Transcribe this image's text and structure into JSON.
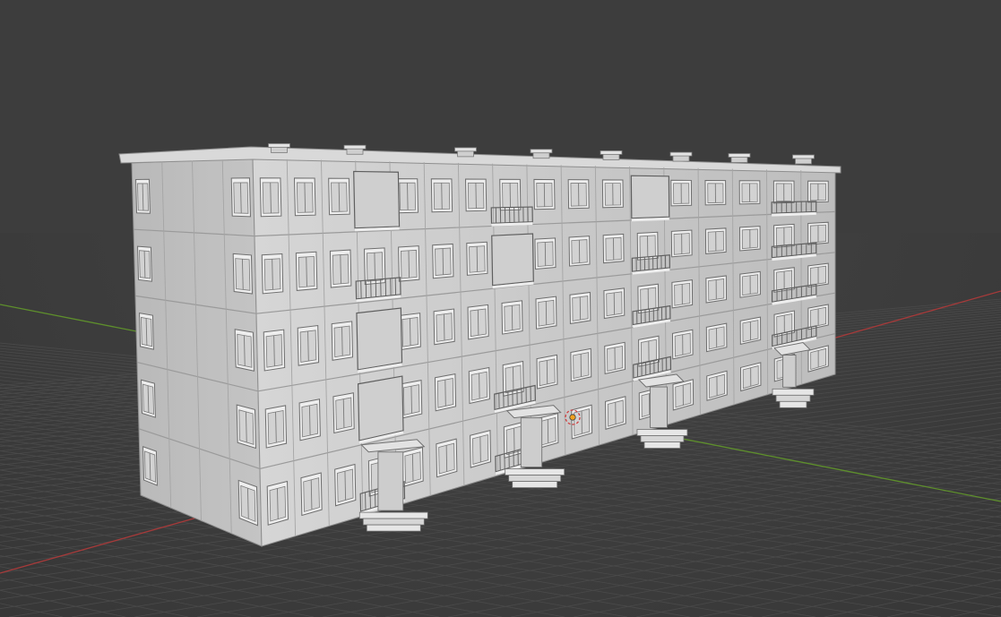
{
  "viewport": {
    "mode": "3d-viewport",
    "shading": "solid",
    "colors": {
      "background": "#3d3d3d",
      "grid": "#4a4a4a",
      "x_axis": "#a63a3a",
      "y_axis": "#5e8f2c",
      "model": "#c9c9c9",
      "origin": "#f0a020"
    }
  },
  "scene": {
    "object": "apartment-block",
    "floors": 5,
    "entrances": 4,
    "roof_vents": 8
  }
}
